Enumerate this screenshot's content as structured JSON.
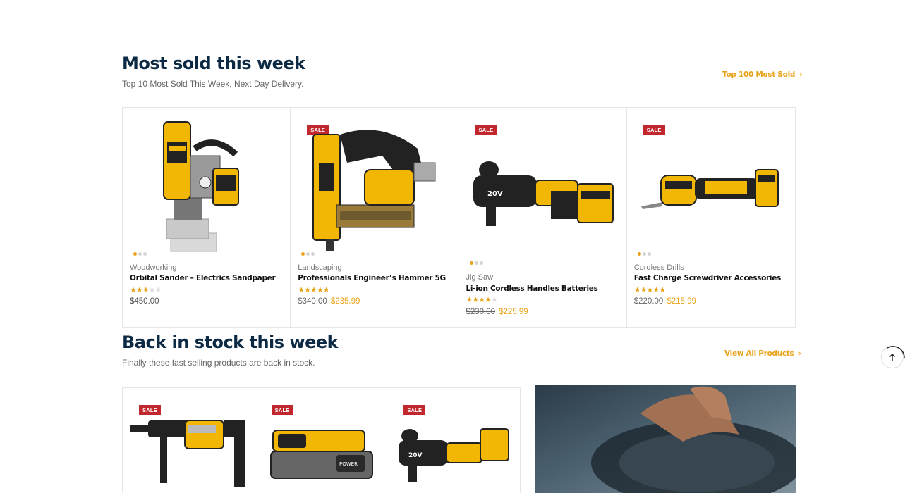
{
  "sections": {
    "most_sold": {
      "title": "Most sold this week",
      "subtitle": "Top 10 Most Sold This Week, Next Day Delivery.",
      "link_label": "Top 100 Most Sold"
    },
    "back_in_stock": {
      "title": "Back in stock this week",
      "subtitle": "Finally these fast selling products are back in stock.",
      "link_label": "View All Products"
    }
  },
  "sale_badge": "SALE",
  "products": [
    {
      "category": "Woodworking",
      "name": "Orbital Sander – Electrics Sandpaper",
      "rating": 3,
      "price": "$450.00",
      "old_price": "",
      "on_sale": false
    },
    {
      "category": "Landscaping",
      "name": "Professionals Engineer’s Hammer 5G",
      "rating": 5,
      "price": "$235.99",
      "old_price": "$340.00",
      "on_sale": true
    },
    {
      "category": "Jig Saw",
      "name": "Li-ion Cordless Handles Batteries",
      "rating": 4,
      "price": "$225.99",
      "old_price": "$230.00",
      "on_sale": true
    },
    {
      "category": "Cordless Drills",
      "name": "Fast Charge Screwdriver Accessories",
      "rating": 5,
      "price": "$215.99",
      "old_price": "$220.00",
      "on_sale": true
    }
  ],
  "back_in_stock_items": [
    {
      "image": "rotary-hammer-drill",
      "on_sale": true
    },
    {
      "image": "powerstack-battery",
      "on_sale": true
    },
    {
      "image": "right-angle-drill",
      "on_sale": true
    }
  ],
  "colors": {
    "accent": "#e9a319",
    "heading": "#0d2a45",
    "sale": "#c1272d",
    "dewalt_yellow": "#f2b705"
  },
  "icons": {
    "link_chevron": "chevron-right-icon",
    "scroll_top": "arrow-up-icon"
  }
}
